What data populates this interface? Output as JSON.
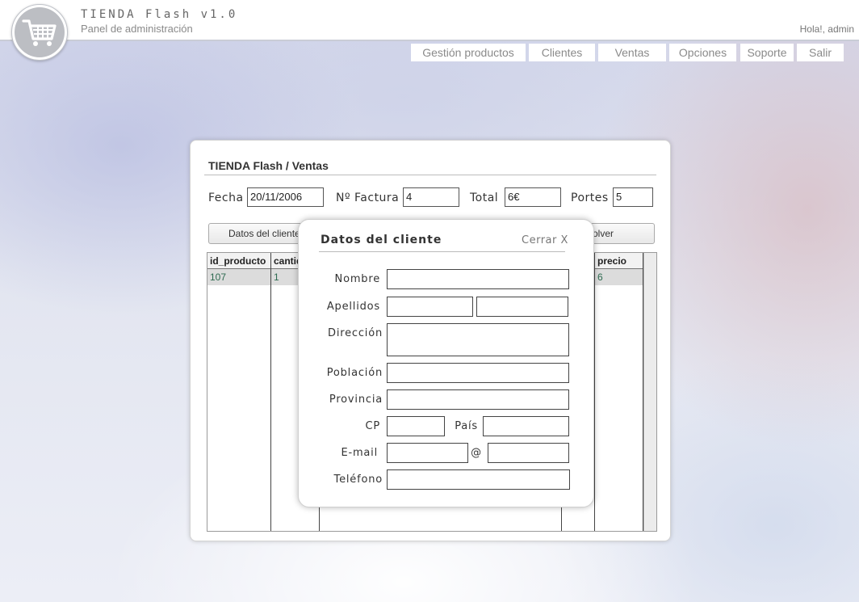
{
  "header": {
    "title": "TIENDA Flash v1.0",
    "subtitle": "Panel de administración",
    "greeting": "Hola!, admin"
  },
  "nav": {
    "items": [
      "Gestión productos",
      "Clientes",
      "Ventas",
      "Opciones",
      "Soporte",
      "Salir"
    ]
  },
  "panel": {
    "title": "TIENDA Flash / Ventas",
    "fecha_label": "Fecha",
    "fecha_value": "20/11/2006",
    "factura_label": "Nº Factura",
    "factura_value": "4",
    "total_label": "Total",
    "total_value": "6€",
    "portes_label": "Portes",
    "portes_value": "5",
    "tab_cliente": "Datos del cliente",
    "tab_volver": "Volver",
    "grid": {
      "columns": [
        "id_producto",
        "cantidad",
        "",
        "",
        "precio"
      ],
      "rows": [
        [
          "107",
          "1",
          "",
          "",
          "6"
        ]
      ]
    }
  },
  "modal": {
    "title": "Datos del cliente",
    "close": "Cerrar X",
    "labels": {
      "nombre": "Nombre",
      "apellidos": "Apellidos",
      "direccion": "Dirección",
      "poblacion": "Población",
      "provincia": "Provincia",
      "cp": "CP",
      "pais": "País",
      "email": "E-mail",
      "at": "@",
      "telefono": "Teléfono"
    },
    "values": {
      "nombre": "",
      "apellido1": "",
      "apellido2": "",
      "direccion": "",
      "poblacion": "",
      "provincia": "",
      "cp": "",
      "pais": "",
      "email_user": "",
      "email_domain": "",
      "telefono": ""
    }
  }
}
